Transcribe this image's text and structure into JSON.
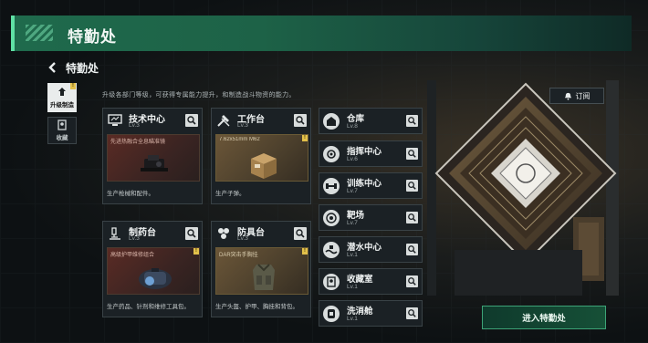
{
  "header": {
    "title": "特勤处"
  },
  "page": {
    "title": "特勤处",
    "subtitle": "升级各部门等级，可获得专属能力提升，和制造战斗物资的能力。"
  },
  "side_tabs": [
    {
      "label": "升级制造",
      "active": true,
      "badge": "!"
    },
    {
      "label": "收藏",
      "active": false
    }
  ],
  "cards": [
    {
      "name": "技术中心",
      "level": "Lv.3",
      "item": "先进热融合全息瞄准镜",
      "desc": "生产枪械和配件。",
      "tone": "red",
      "icon": "monitor-icon"
    },
    {
      "name": "工作台",
      "level": "Lv.3",
      "item": "7.62x51mm M62",
      "desc": "生产子弹。",
      "tone": "gold",
      "badge": "!",
      "icon": "hammer-icon"
    },
    {
      "name": "制药台",
      "level": "Lv.3",
      "item": "高级护甲维修组合",
      "desc": "生产药品、针剂和维修工具包。",
      "tone": "red",
      "badge": "!",
      "icon": "microscope-icon"
    },
    {
      "name": "防具台",
      "level": "Lv.3",
      "item": "DAR突击手胸挂",
      "desc": "生产头盔、护甲、胸挂和背包。",
      "tone": "gold",
      "badge": "!",
      "icon": "gear-icon"
    }
  ],
  "facilities": [
    {
      "name": "仓库",
      "level": "Lv.8"
    },
    {
      "name": "指挥中心",
      "level": "Lv.6"
    },
    {
      "name": "训练中心",
      "level": "Lv.7"
    },
    {
      "name": "靶场",
      "level": "Lv.7"
    },
    {
      "name": "潜水中心",
      "level": "Lv.1"
    },
    {
      "name": "收藏室",
      "level": "Lv.1"
    },
    {
      "name": "洗消舱",
      "level": "Lv.1"
    }
  ],
  "actions": {
    "subscribe": "订阅",
    "enter": "进入特勤处"
  },
  "colors": {
    "accent": "#1f6a4c",
    "badge": "#e2c04a"
  }
}
